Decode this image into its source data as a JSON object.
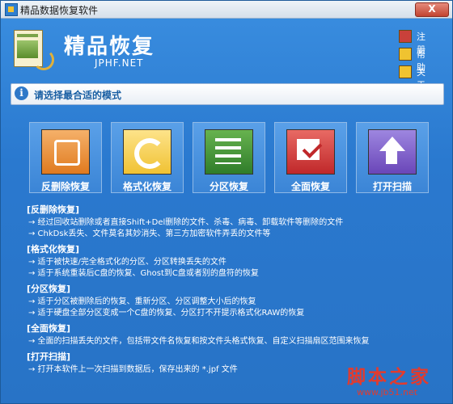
{
  "window": {
    "title": "精品数据恢复软件",
    "close_label": "X"
  },
  "brand": {
    "name": "精品恢复",
    "sub": "JPHF.NET"
  },
  "toplinks": [
    {
      "label": "注册",
      "icon": "register-icon"
    },
    {
      "label": "帮助",
      "icon": "help-icon"
    },
    {
      "label": "关于",
      "icon": "about-icon"
    }
  ],
  "info": {
    "icon": "i",
    "text": "请选择最合适的模式"
  },
  "modes": [
    {
      "label": "反删除恢复",
      "icon": "recycle-icon",
      "color": "#e07a1f"
    },
    {
      "label": "格式化恢复",
      "icon": "refresh-icon",
      "color": "#f0c233"
    },
    {
      "label": "分区恢复",
      "icon": "checklist-icon",
      "color": "#2f7d2a"
    },
    {
      "label": "全面恢复",
      "icon": "checkbox-icon",
      "color": "#c0282a"
    },
    {
      "label": "打开扫描",
      "icon": "upload-icon",
      "color": "#6a46b8"
    }
  ],
  "descriptions": [
    {
      "heading": "[反删除恢复]",
      "lines": [
        "→ 经过回收站删除或者直接Shift+Del删除的文件、杀毒、病毒、卸载软件等删除的文件",
        "→ ChkDsk丢失、文件莫名其妙消失、第三方加密软件弄丢的文件等"
      ]
    },
    {
      "heading": "[格式化恢复]",
      "lines": [
        "→ 适于被快速/完全格式化的分区、分区转换丢失的文件",
        "→ 适于系统重装后C盘的恢复、Ghost到C盘或者别的盘符的恢复"
      ]
    },
    {
      "heading": "[分区恢复]",
      "lines": [
        "→ 适于分区被删除后的恢复、重新分区、分区调整大小后的恢复",
        "→ 适于硬盘全部分区变成一个C盘的恢复、分区打不开提示格式化RAW的恢复"
      ]
    },
    {
      "heading": "[全面恢复]",
      "lines": [
        "→ 全面的扫描丢失的文件，包括带文件名恢复和按文件头格式恢复、自定义扫描扇区范围来恢复"
      ]
    },
    {
      "heading": "[打开扫描]",
      "lines": [
        "→ 打开本软件上一次扫描到数据后，保存出来的 *.jpf 文件"
      ]
    }
  ],
  "watermark": {
    "text": "脚本之家",
    "url": "www.jb51.net"
  }
}
